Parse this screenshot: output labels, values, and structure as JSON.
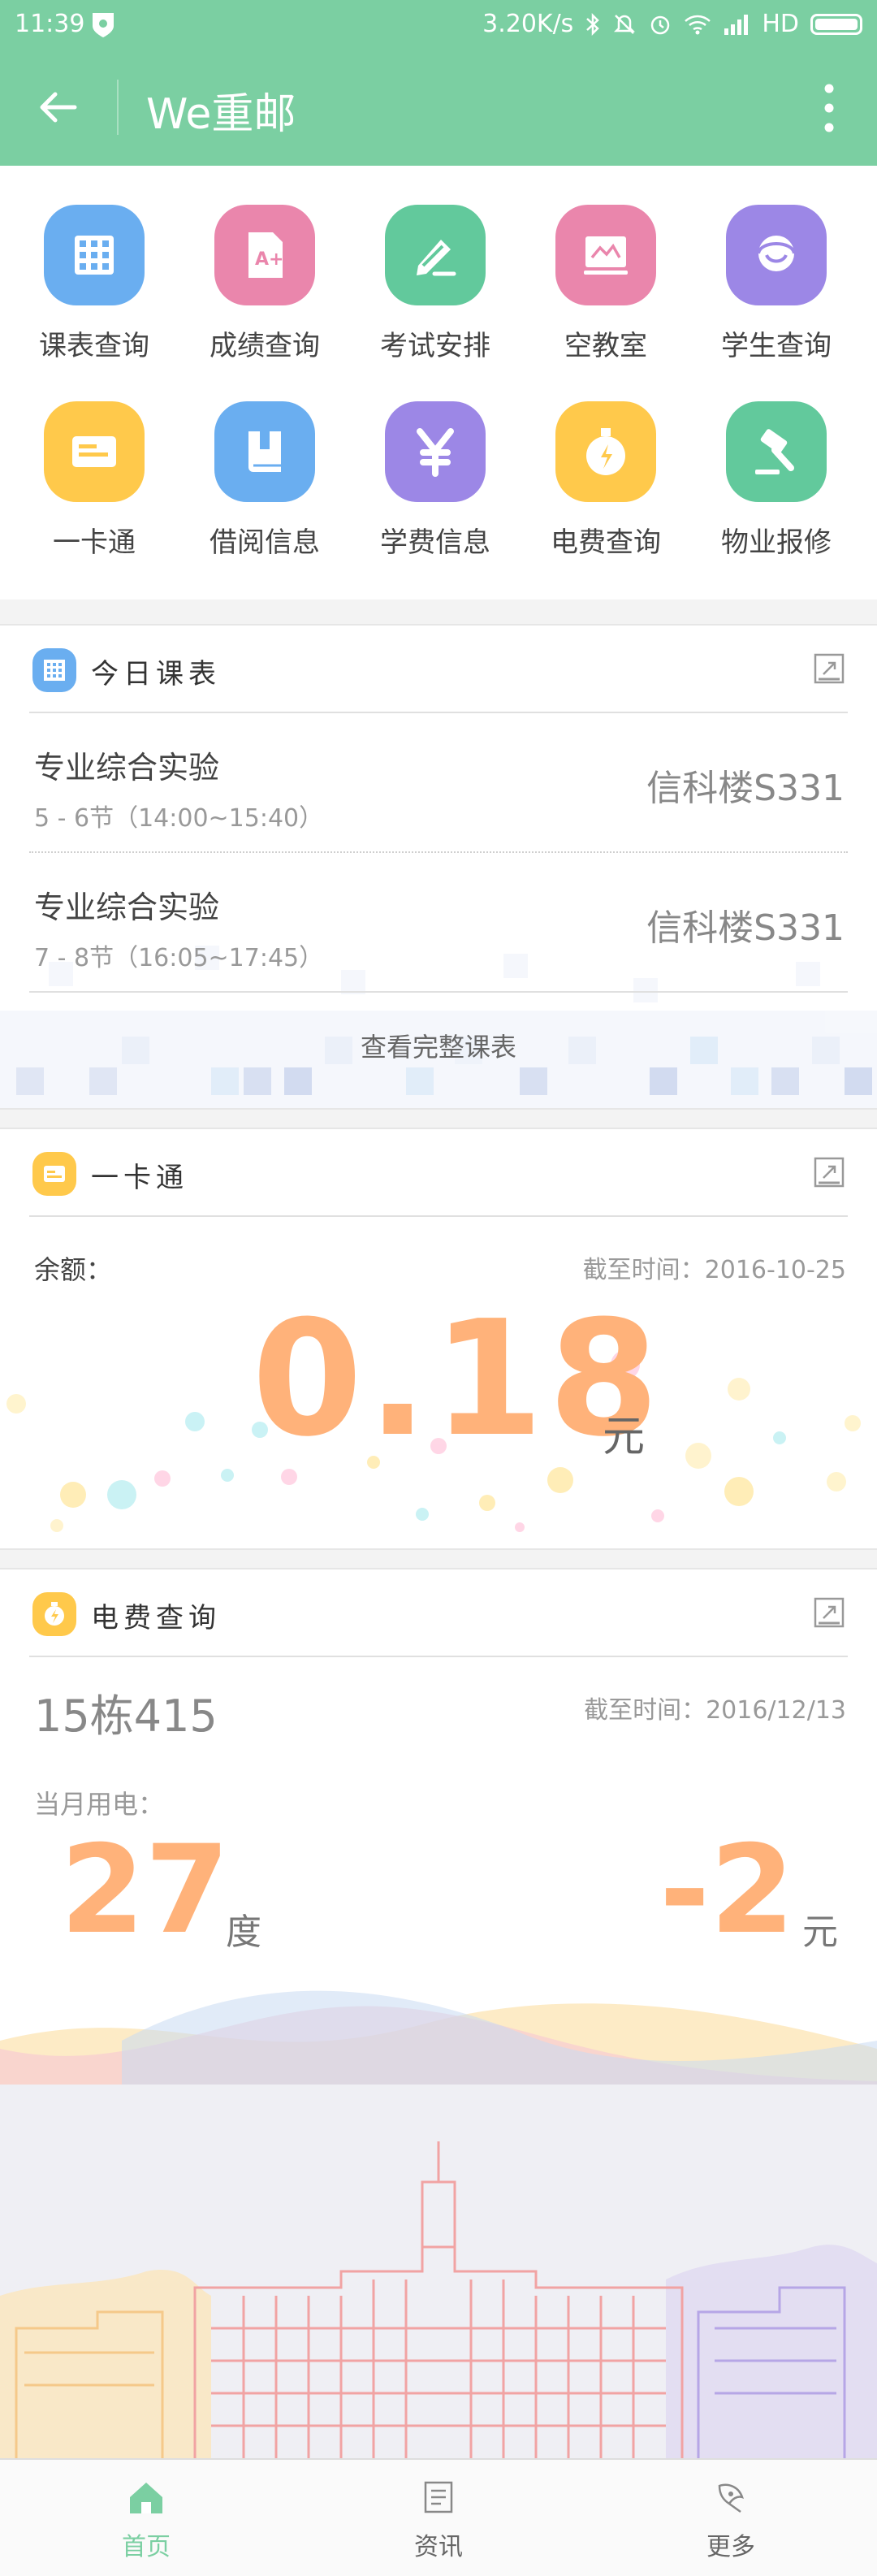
{
  "status_bar": {
    "time": "11:39",
    "net_speed": "3.20K/s",
    "hd_label": "HD"
  },
  "app_bar": {
    "title": "We重邮"
  },
  "grid": [
    {
      "label": "课表查询",
      "icon": "timetable-icon",
      "color": "#6aaef0"
    },
    {
      "label": "成绩查询",
      "icon": "grade-icon",
      "color": "#ea86ac"
    },
    {
      "label": "考试安排",
      "icon": "exam-pencil-icon",
      "color": "#62c99c"
    },
    {
      "label": "空教室",
      "icon": "classroom-icon",
      "color": "#ea86ac"
    },
    {
      "label": "学生查询",
      "icon": "student-icon",
      "color": "#9c87e6"
    },
    {
      "label": "一卡通",
      "icon": "card-icon",
      "color": "#ffc94b"
    },
    {
      "label": "借阅信息",
      "icon": "book-icon",
      "color": "#6aaef0"
    },
    {
      "label": "学费信息",
      "icon": "yen-icon",
      "color": "#9c87e6"
    },
    {
      "label": "电费查询",
      "icon": "electricity-icon",
      "color": "#ffc94b"
    },
    {
      "label": "物业报修",
      "icon": "hammer-icon",
      "color": "#62c99c"
    }
  ],
  "today_schedule": {
    "title": "今日课表",
    "courses": [
      {
        "name": "专业综合实验",
        "time": "5 - 6节（14:00~15:40）",
        "room": "信科楼S331"
      },
      {
        "name": "专业综合实验",
        "time": "7 - 8节（16:05~17:45）",
        "room": "信科楼S331"
      }
    ],
    "view_all": "查看完整课表"
  },
  "card": {
    "title": "一卡通",
    "balance_label": "余额：",
    "as_of": "截至时间：2016-10-25",
    "balance": "0.18",
    "unit": "元"
  },
  "electricity": {
    "title": "电费查询",
    "room": "15栋415",
    "as_of": "截至时间：2016/12/13",
    "month_label": "当月用电：",
    "usage": "27",
    "usage_unit": "度",
    "cost": "-2",
    "cost_unit": "元"
  },
  "bottom_nav": {
    "items": [
      {
        "label": "首页",
        "active": true
      },
      {
        "label": "资讯",
        "active": false
      },
      {
        "label": "更多",
        "active": false
      }
    ]
  },
  "colors": {
    "primary": "#7bcfa2",
    "orange": "#ffb27a",
    "text_muted": "#999999"
  }
}
